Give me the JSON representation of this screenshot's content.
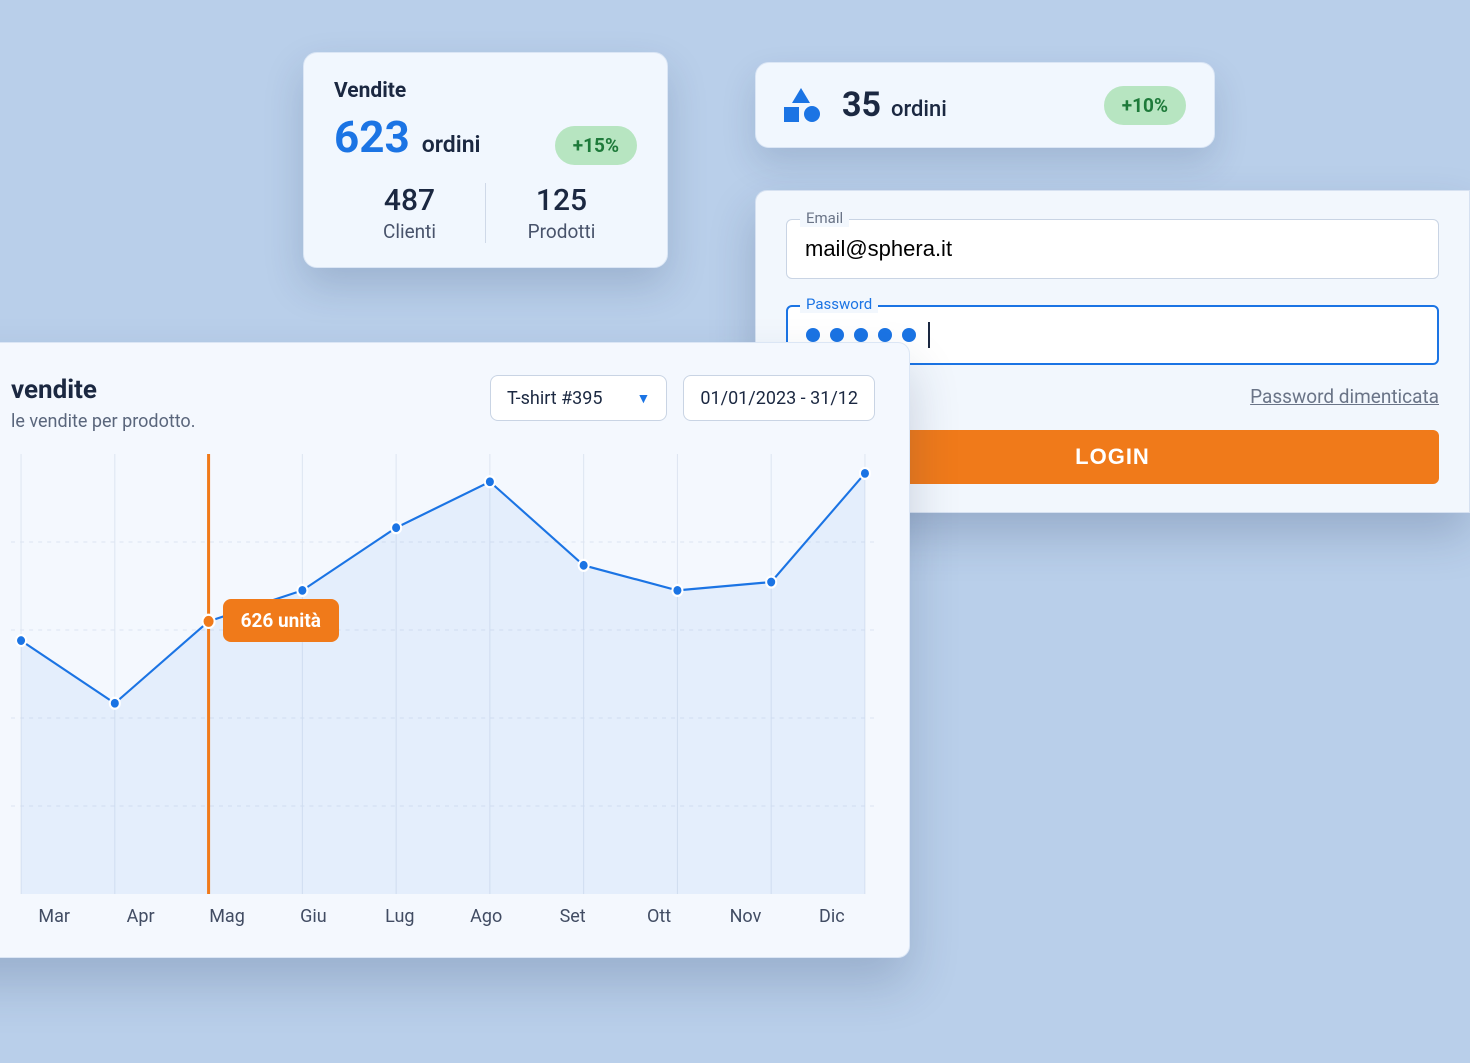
{
  "vendite": {
    "title": "Vendite",
    "orders_num": "623",
    "orders_label": "ordini",
    "change": "+15%",
    "clients_num": "487",
    "clients_label": "Clienti",
    "products_num": "125",
    "products_label": "Prodotti"
  },
  "ordini_card": {
    "num": "35",
    "label": "ordini",
    "change": "+10%"
  },
  "login": {
    "email_label": "Email",
    "email_value": "mail@sphera.it",
    "password_label": "Password",
    "password_dots": 5,
    "forgot": "Password dimenticata",
    "button": "LOGIN"
  },
  "sales_chart": {
    "title": "vendite",
    "subtitle": "le vendite per prodotto.",
    "product_select": "T-shirt #395",
    "date_range": "01/01/2023 - 31/12",
    "tooltip_month": "Mag",
    "tooltip_value": "626 unità"
  },
  "chart_data": {
    "type": "line",
    "categories": [
      "Mar",
      "Apr",
      "Mag",
      "Giu",
      "Lug",
      "Ago",
      "Set",
      "Ott",
      "Nov",
      "Dic"
    ],
    "values": [
      580,
      430,
      626,
      700,
      850,
      960,
      760,
      700,
      720,
      980
    ],
    "highlight_index": 2,
    "ylim": [
      0,
      1000
    ],
    "title": "vendite",
    "xlabel": "",
    "ylabel": ""
  },
  "colors": {
    "accent_blue": "#1b74e4",
    "accent_orange": "#f07a1a",
    "badge_green": "#b7e5c1"
  }
}
